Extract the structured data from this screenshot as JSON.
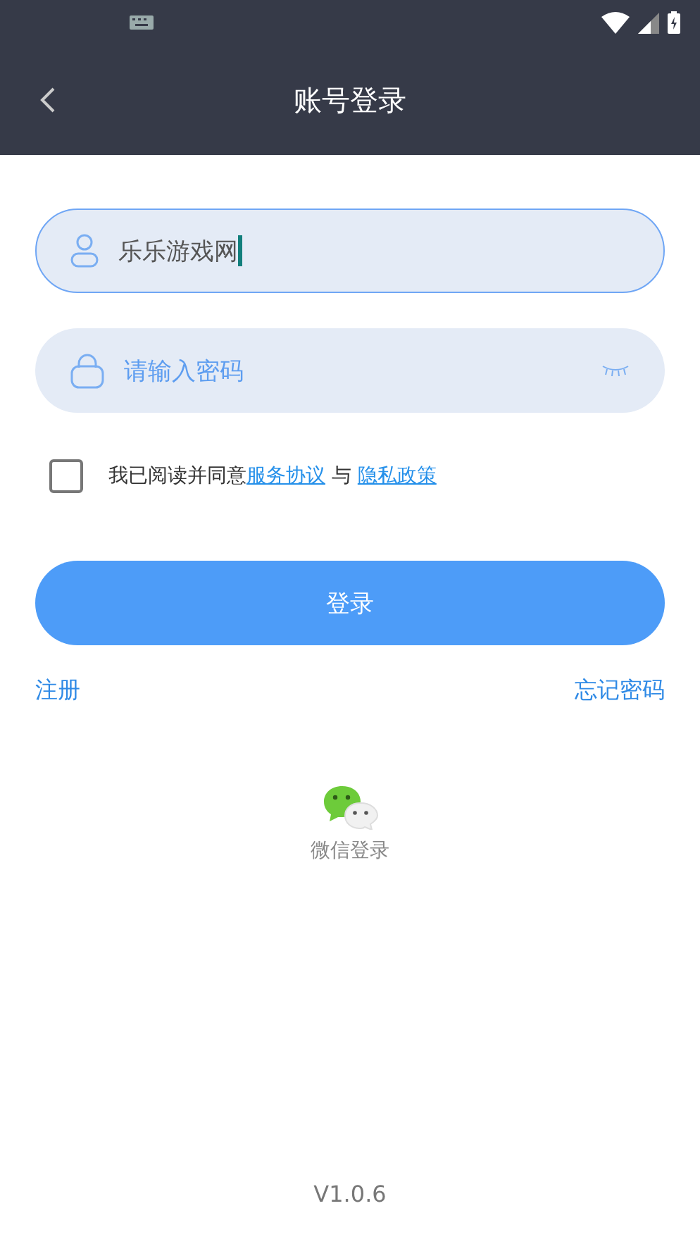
{
  "header": {
    "title": "账号登录"
  },
  "username": {
    "value": "乐乐游戏网",
    "focused": true
  },
  "password": {
    "placeholder": "请输入密码",
    "visible": false
  },
  "agreement": {
    "checked": false,
    "prefix": "我已阅读并同意",
    "joiner": " 与 ",
    "links": [
      "服务协议",
      "隐私政策"
    ]
  },
  "login_button": "登录",
  "links": {
    "register": "注册",
    "forgot": "忘记密码"
  },
  "wechat": {
    "label": "微信登录"
  },
  "version": "V1.0.6"
}
